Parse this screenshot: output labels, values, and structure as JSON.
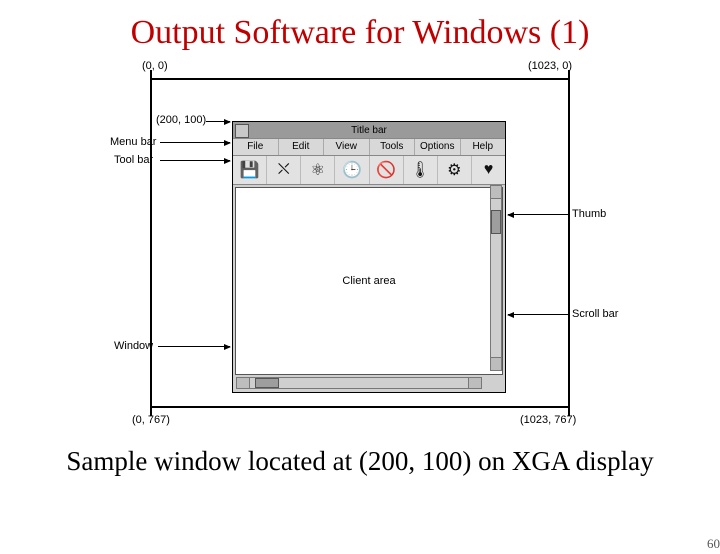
{
  "title": "Output Software for Windows (1)",
  "caption": "Sample window located at (200, 100) on XGA display",
  "page_number": "60",
  "coords": {
    "tl": "(0, 0)",
    "tr": "(1023, 0)",
    "bl": "(0, 767)",
    "br": "(1023, 767)",
    "win_origin": "(200, 100)"
  },
  "callouts": {
    "menu_bar": "Menu bar",
    "tool_bar": "Tool bar",
    "window": "Window",
    "thumb": "Thumb",
    "scroll_bar": "Scroll bar"
  },
  "window": {
    "title_bar": "Title bar",
    "menus": [
      "File",
      "Edit",
      "View",
      "Tools",
      "Options",
      "Help"
    ],
    "toolbar_icons": [
      "floppy-icon",
      "person-icon",
      "atom-icon",
      "clock-icon",
      "nosmoking-icon",
      "thermometer-icon",
      "gear-icon",
      "heart-icon"
    ],
    "toolbar_glyphs": [
      "💾",
      "⛌",
      "⚛",
      "🕒",
      "🚫",
      "🌡",
      "⚙",
      "♥"
    ],
    "client_area": "Client area"
  }
}
